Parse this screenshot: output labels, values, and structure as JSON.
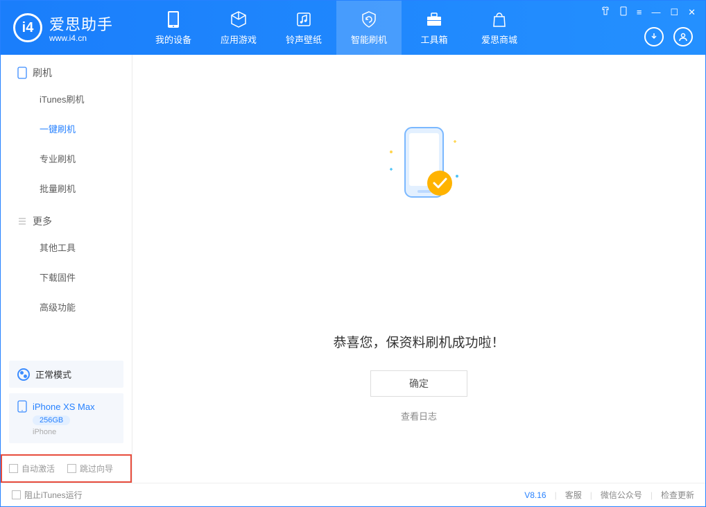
{
  "app": {
    "name": "爱思助手",
    "url": "www.i4.cn"
  },
  "tabs": {
    "mydevice": "我的设备",
    "appgame": "应用游戏",
    "ringtone": "铃声壁纸",
    "smartflash": "智能刷机",
    "toolbox": "工具箱",
    "store": "爱思商城"
  },
  "sidebar": {
    "section_flash": "刷机",
    "items_flash": {
      "itunes": "iTunes刷机",
      "oneclick": "一键刷机",
      "pro": "专业刷机",
      "batch": "批量刷机"
    },
    "section_more": "更多",
    "items_more": {
      "othertools": "其他工具",
      "firmware": "下载固件",
      "advanced": "高级功能"
    }
  },
  "device": {
    "mode": "正常模式",
    "name": "iPhone XS Max",
    "storage": "256GB",
    "type": "iPhone"
  },
  "checks": {
    "auto_activate": "自动激活",
    "skip_guide": "跳过向导"
  },
  "main": {
    "success_msg": "恭喜您，保资料刷机成功啦！",
    "ok": "确定",
    "view_log": "查看日志"
  },
  "footer": {
    "block_itunes": "阻止iTunes运行",
    "version": "V8.16",
    "support": "客服",
    "wechat": "微信公众号",
    "update": "检查更新"
  }
}
